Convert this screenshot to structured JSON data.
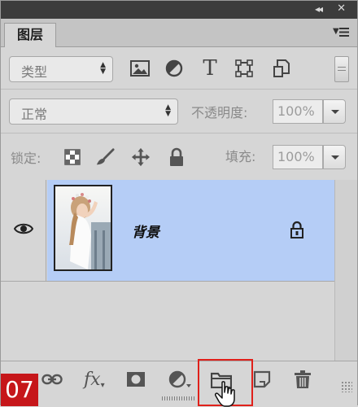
{
  "panel": {
    "collapse_glyph": "◂◂",
    "close_glyph": "✕",
    "tab_label": "图层",
    "menu_icon": "panel-menu-icon"
  },
  "filter": {
    "kind_label": "类型",
    "icons": [
      "image-filter-icon",
      "adjustment-filter-icon",
      "type-filter-icon",
      "shape-filter-icon",
      "smart-object-filter-icon"
    ],
    "type_glyph": "T"
  },
  "blend": {
    "mode_label": "正常",
    "opacity_label": "不透明度:",
    "opacity_value": "100%"
  },
  "lock": {
    "label": "锁定:",
    "fill_label": "填充:",
    "fill_value": "100%"
  },
  "layers": [
    {
      "name": "背景",
      "visible": true,
      "locked": true,
      "selected": true
    }
  ],
  "bottom_bar": {
    "icons": [
      "link-layers-icon",
      "fx-icon",
      "add-mask-icon",
      "adjustment-layer-icon",
      "new-group-icon",
      "new-layer-icon",
      "delete-layer-icon"
    ],
    "fx_label": "fx",
    "highlighted": "new-group-icon"
  },
  "step_badge": "07",
  "colors": {
    "selection": "#b5cdf6",
    "highlight": "#e0201a",
    "badge": "#c6161a"
  }
}
